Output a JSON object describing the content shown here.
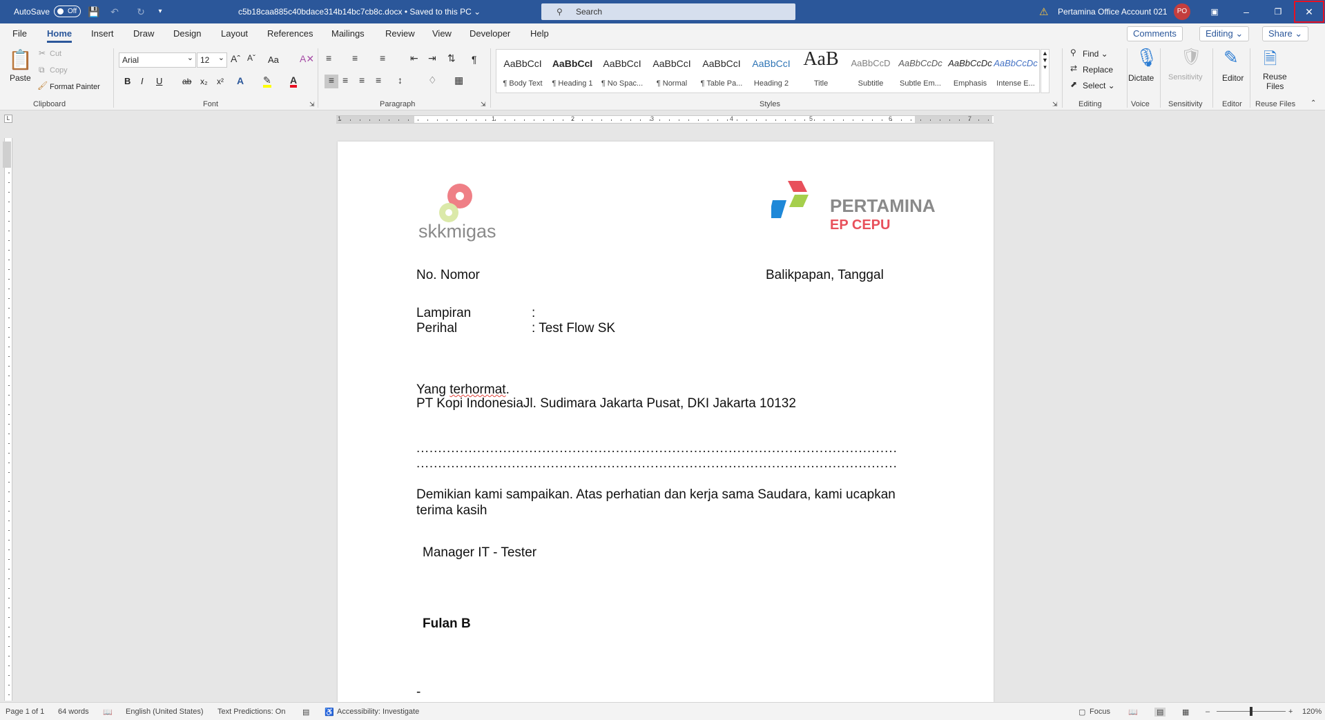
{
  "titlebar": {
    "autosave_label": "AutoSave",
    "autosave_state": "Off",
    "doc_title": "c5b18caa885c40bdace314b14bc7cb8c.docx • Saved to this PC ⌄",
    "search_placeholder": "Search",
    "account": "Pertamina Office Account 021",
    "avatar_initials": "PO",
    "accent": "#2b579a"
  },
  "menu": {
    "tabs": [
      "File",
      "Home",
      "Insert",
      "Draw",
      "Design",
      "Layout",
      "References",
      "Mailings",
      "Review",
      "View",
      "Developer",
      "Help"
    ],
    "active": "Home",
    "comments": "Comments",
    "editing": "Editing ⌄",
    "share": "Share ⌄"
  },
  "ribbon": {
    "clipboard": {
      "paste": "Paste",
      "cut": "Cut",
      "copy": "Copy",
      "format_painter": "Format Painter",
      "label": "Clipboard"
    },
    "font": {
      "name": "Arial",
      "size": "12",
      "change_case": "Aa",
      "label": "Font",
      "bold": "B",
      "italic": "I",
      "underline": "U",
      "strike": "ab",
      "sub": "x₂",
      "sup": "x²"
    },
    "paragraph": {
      "label": "Paragraph",
      "pilcrow": "¶"
    },
    "styles": {
      "label": "Styles",
      "items": [
        {
          "preview": "AaBbCcI",
          "name": "¶ Body Text"
        },
        {
          "preview": "AaBbCcI",
          "name": "¶ Heading 1"
        },
        {
          "preview": "AaBbCcI",
          "name": "¶ No Spac..."
        },
        {
          "preview": "AaBbCcI",
          "name": "¶ Normal"
        },
        {
          "preview": "AaBbCcI",
          "name": "¶ Table Pa..."
        },
        {
          "preview": "AaBbCcI",
          "name": "Heading 2"
        },
        {
          "preview": "AaB",
          "name": "Title"
        },
        {
          "preview": "AaBbCcD",
          "name": "Subtitle"
        },
        {
          "preview": "AaBbCcDc",
          "name": "Subtle Em..."
        },
        {
          "preview": "AaBbCcDc",
          "name": "Emphasis"
        },
        {
          "preview": "AaBbCcDc",
          "name": "Intense E..."
        }
      ]
    },
    "editing": {
      "find": "Find ⌄",
      "replace": "Replace",
      "select": "Select ⌄",
      "label": "Editing"
    },
    "voice": {
      "dictate": "Dictate",
      "label": "Voice"
    },
    "sensitivity": {
      "button": "Sensitivity",
      "label": "Sensitivity"
    },
    "editor": {
      "button": "Editor",
      "label": "Editor"
    },
    "reuse": {
      "button_line1": "Reuse",
      "button_line2": "Files",
      "label": "Reuse Files"
    }
  },
  "ruler": {
    "numbers": [
      "1",
      "1",
      "2",
      "3",
      "4",
      "5",
      "6",
      "7"
    ]
  },
  "document": {
    "logo_left": "skkmigas",
    "logo_right_1": "PERTAMINA",
    "logo_right_2": "EP CEPU",
    "nomor": "No. Nomor",
    "tanggal": "Balikpapan, Tanggal",
    "lampiran_label": "Lampiran",
    "lampiran_colon": ":",
    "perihal_label": "Perihal",
    "perihal_value": ":   Test Flow SK",
    "salutation_1": "Yang ",
    "salutation_2": "terhormat",
    "salutation_3": ".",
    "address": "PT Kopi IndonesiaJl. Sudimara Jakarta Pusat, DKI Jakarta 10132",
    "dots_1": "...............................................................................................................",
    "dots_2": "...............................................................................................................",
    "closing_1": "Demikian  kami  sampaikan.  Atas  perhatian  dan  kerja  sama  Saudara,  kami  ucapkan",
    "closing_2": "terima kasih",
    "signer_title": "Manager IT - Tester",
    "signer_name": "Fulan B",
    "dash": "-"
  },
  "status": {
    "page": "Page 1 of 1",
    "words": "64 words",
    "language": "English (United States)",
    "predictions": "Text Predictions: On",
    "accessibility": "Accessibility: Investigate",
    "focus": "Focus",
    "zoom": "120%"
  }
}
